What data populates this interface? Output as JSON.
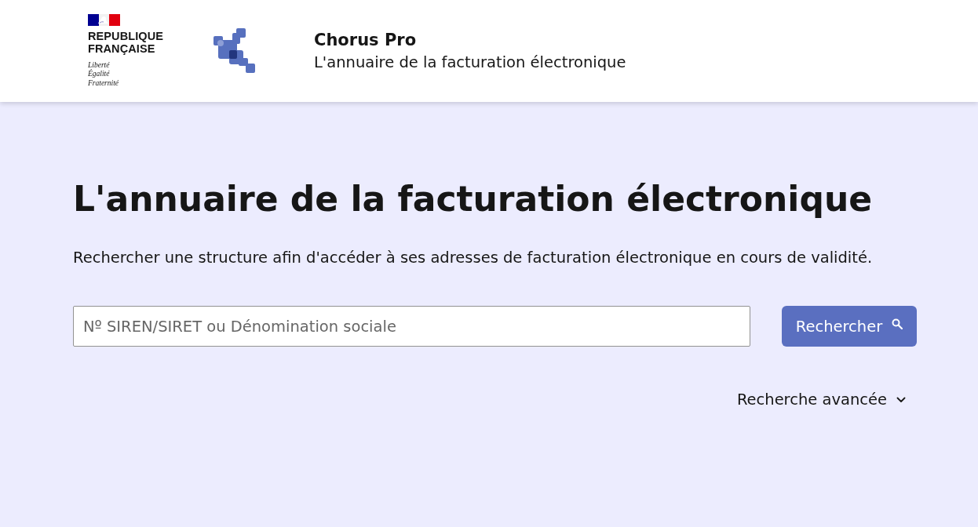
{
  "header": {
    "logo": {
      "lines": [
        "REPUBLIQUE",
        "FRANÇAISE"
      ],
      "motto": [
        "Liberté",
        "Égalité",
        "Fraternité"
      ]
    },
    "service": {
      "title": "Chorus Pro",
      "tagline": "L'annuaire de la facturation électronique"
    }
  },
  "main": {
    "heading": "L'annuaire de la facturation électronique",
    "description": "Rechercher une structure afin d'accéder à ses adresses de facturation électronique en cours de validité.",
    "search": {
      "placeholder": "Nº SIREN/SIRET ou Dénomination sociale"
    },
    "search_button": {
      "label": "Rechercher"
    },
    "advanced_search": {
      "label": "Recherche avancée",
      "expanded": false
    }
  }
}
